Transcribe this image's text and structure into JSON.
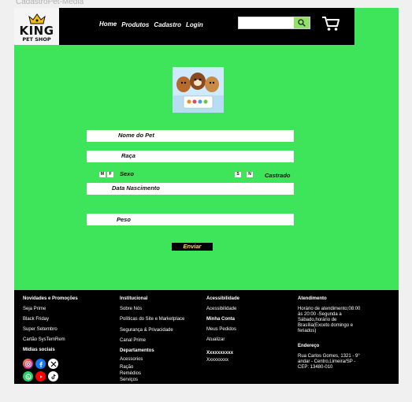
{
  "frame_title": "CadastroPet-Media",
  "logo": {
    "line1": "KING",
    "line2": "PET SHOP"
  },
  "nav": {
    "home": "Home",
    "produtos": "Produtos",
    "cadastro": "Cadastro",
    "login": "Login"
  },
  "search": {
    "value": "",
    "placeholder": ""
  },
  "form": {
    "nome_label": "Nome do Pet",
    "raca_label": "Raça",
    "sexo_m": "M",
    "sexo_f": "F",
    "sexo_label": "Sexo",
    "castrado_s": "S",
    "castrado_n": "N",
    "castrado_label": "Castrado",
    "data_label": "Data Nascimento",
    "peso_label": "Peso",
    "submit": "Enviar"
  },
  "footer": {
    "col1": {
      "title": "Novidades e Promoções",
      "items": [
        "Seja Prime",
        "Black Friday",
        "Super Setembro",
        "Cartão SysTemRem"
      ],
      "social_title": "Mídias sociais"
    },
    "col2": {
      "title": "Institucional",
      "items": [
        "Sobre Nós",
        "Políticas do Site e Marketplace",
        "Segurança & Privacidade",
        "Canal Prime"
      ],
      "title2": "Departamentos",
      "items2": [
        "Acessorios",
        "Ração",
        "Remédios",
        "Serviços"
      ]
    },
    "col3": {
      "title": "Acessibilidade",
      "items": [
        "Acessibilidade"
      ],
      "title2": "Minha Conta",
      "items2": [
        "Meus Pedidos",
        "Atualizar"
      ],
      "title3": "Xxxxxxxxxx",
      "items3": [
        "Xxxxxxxxx"
      ]
    },
    "col4": {
      "title": "Atendimento",
      "text": "Horário de atendimento;08:00 às 20:00 -Segunda a Sábado,horário de Brasília(Exceto domingo e feriados)",
      "title2": "Endereço",
      "address": "Rua Carlos Gomes, 1321 - 9° andar - Centro,Limeira/SP - CEP: 13480-010"
    }
  },
  "colors": {
    "brand_green": "#3ee55b",
    "header_black": "#000000",
    "button_text": "#ffd94a"
  }
}
